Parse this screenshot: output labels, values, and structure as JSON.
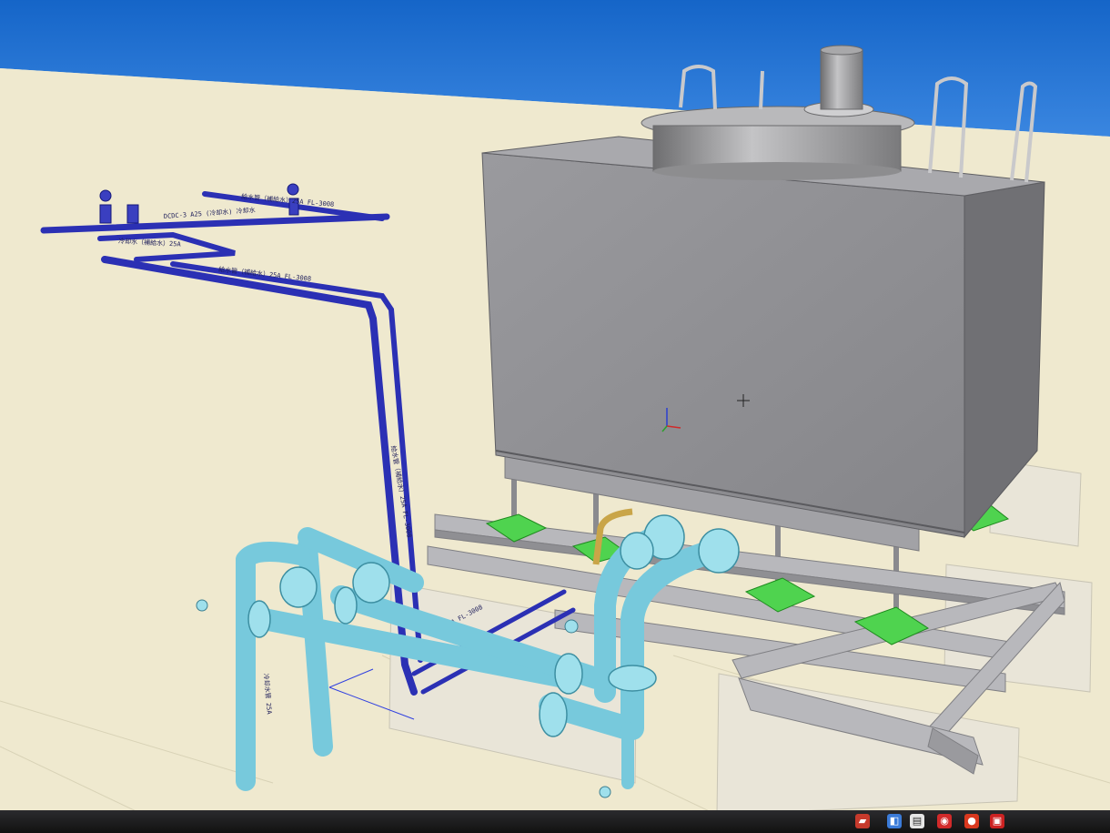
{
  "app": {
    "name": "3D piping CAD viewport",
    "background_top": "#1b6fd0",
    "background_bottom": "#efe9cf"
  },
  "pipe_labels": [
    "DCDC-3 A25 (冷却水) 冷却水",
    "給水管（補給水）25A FL-3008",
    "冷却水（補給水）25A",
    "給水管（補給水）25A FL-3008",
    "25A FL-3008",
    "給水管（補給水）25A FL-3008",
    "冷却水",
    "冷却水管 25A"
  ],
  "colors": {
    "tank_body": "#8c8c90",
    "tank_side": "#6e6e72",
    "blue_pipe": "#2a2fb0",
    "cyan_pipe": "#7fd0e0",
    "damper_green": "#44d14a",
    "steel_beam": "#b4b4b8",
    "foundation": "#e6e2d4"
  },
  "icons": [
    "origin-axis-icon",
    "crosshair-cursor-icon"
  ],
  "taskbar": {
    "icons": [
      {
        "name": "file-icon",
        "glyph": "▤",
        "color": "#e6e6e6"
      },
      {
        "name": "folder-icon",
        "glyph": "▰",
        "color": "#c63a2c"
      },
      {
        "name": "app-icon-a",
        "glyph": "◧",
        "color": "#3b7bd8"
      },
      {
        "name": "app-icon-b",
        "glyph": "◉",
        "color": "#d22a2a"
      },
      {
        "name": "app-icon-c",
        "glyph": "●",
        "color": "#d9381e"
      },
      {
        "name": "app-icon-d",
        "glyph": "▣",
        "color": "#cc2222"
      }
    ]
  }
}
